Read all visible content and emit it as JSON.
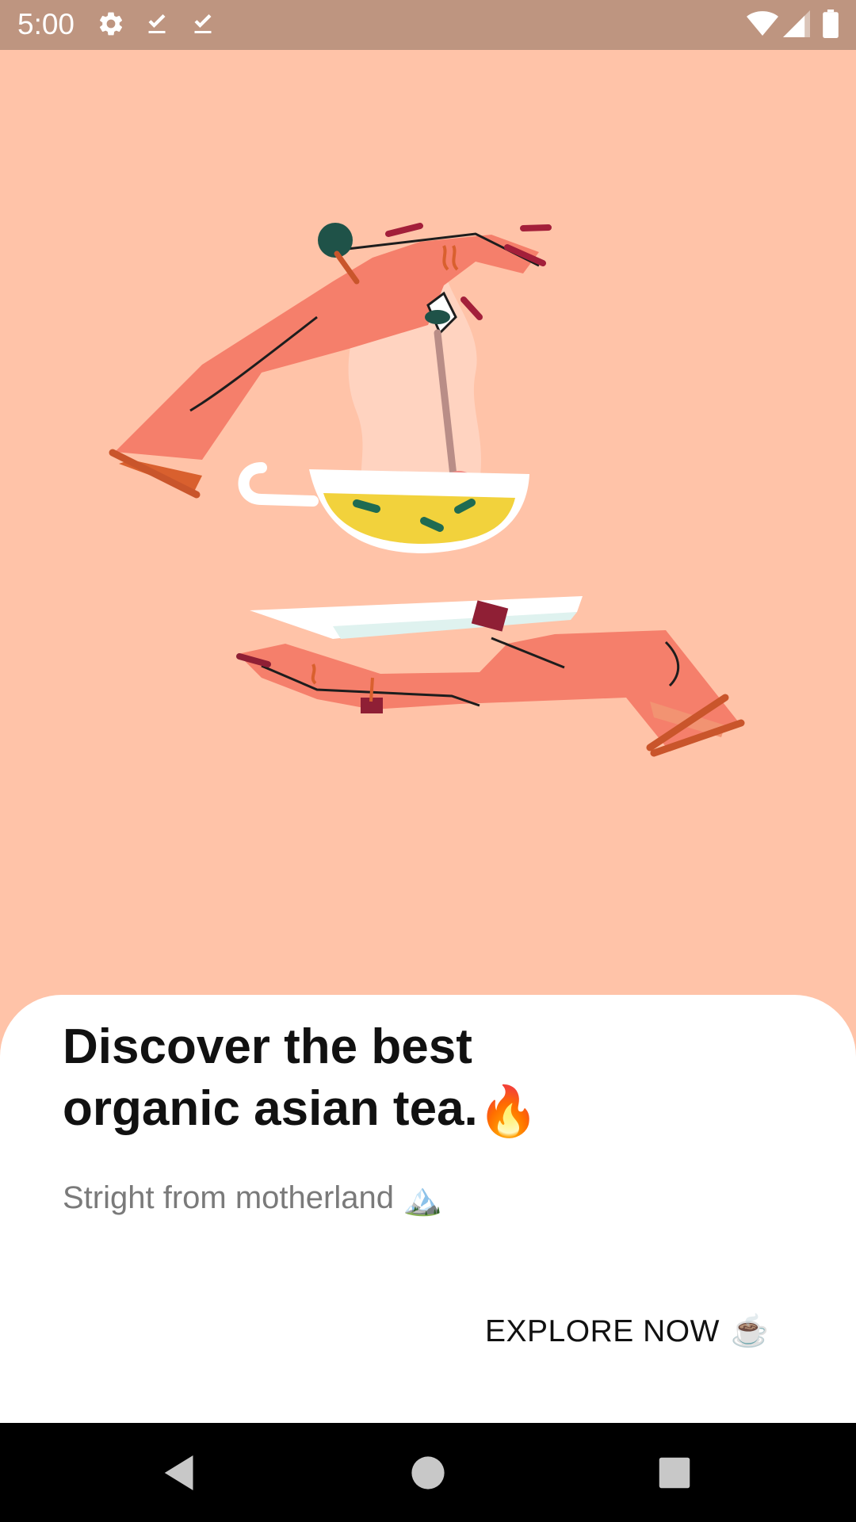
{
  "status_bar": {
    "time": "5:00",
    "left_icons": [
      "settings-icon",
      "download-done-icon",
      "download-done-icon"
    ],
    "right_icons": [
      "wifi-icon",
      "cellular-signal-icon",
      "battery-icon"
    ],
    "background": "#be9580"
  },
  "hero": {
    "background": "#ffc3a8",
    "illustration": "hands-holding-tea-cup-illustration"
  },
  "onboarding": {
    "headline_line1": "Discover the best",
    "headline_line2": "organic asian tea.",
    "headline_emoji": "🔥",
    "subtitle": "Stright from motherland",
    "subtitle_emoji": "🏔️",
    "cta_label": "EXPLORE NOW",
    "cta_emoji": "☕"
  },
  "nav_bar": {
    "buttons": [
      "back-icon",
      "home-icon",
      "recents-icon"
    ]
  }
}
